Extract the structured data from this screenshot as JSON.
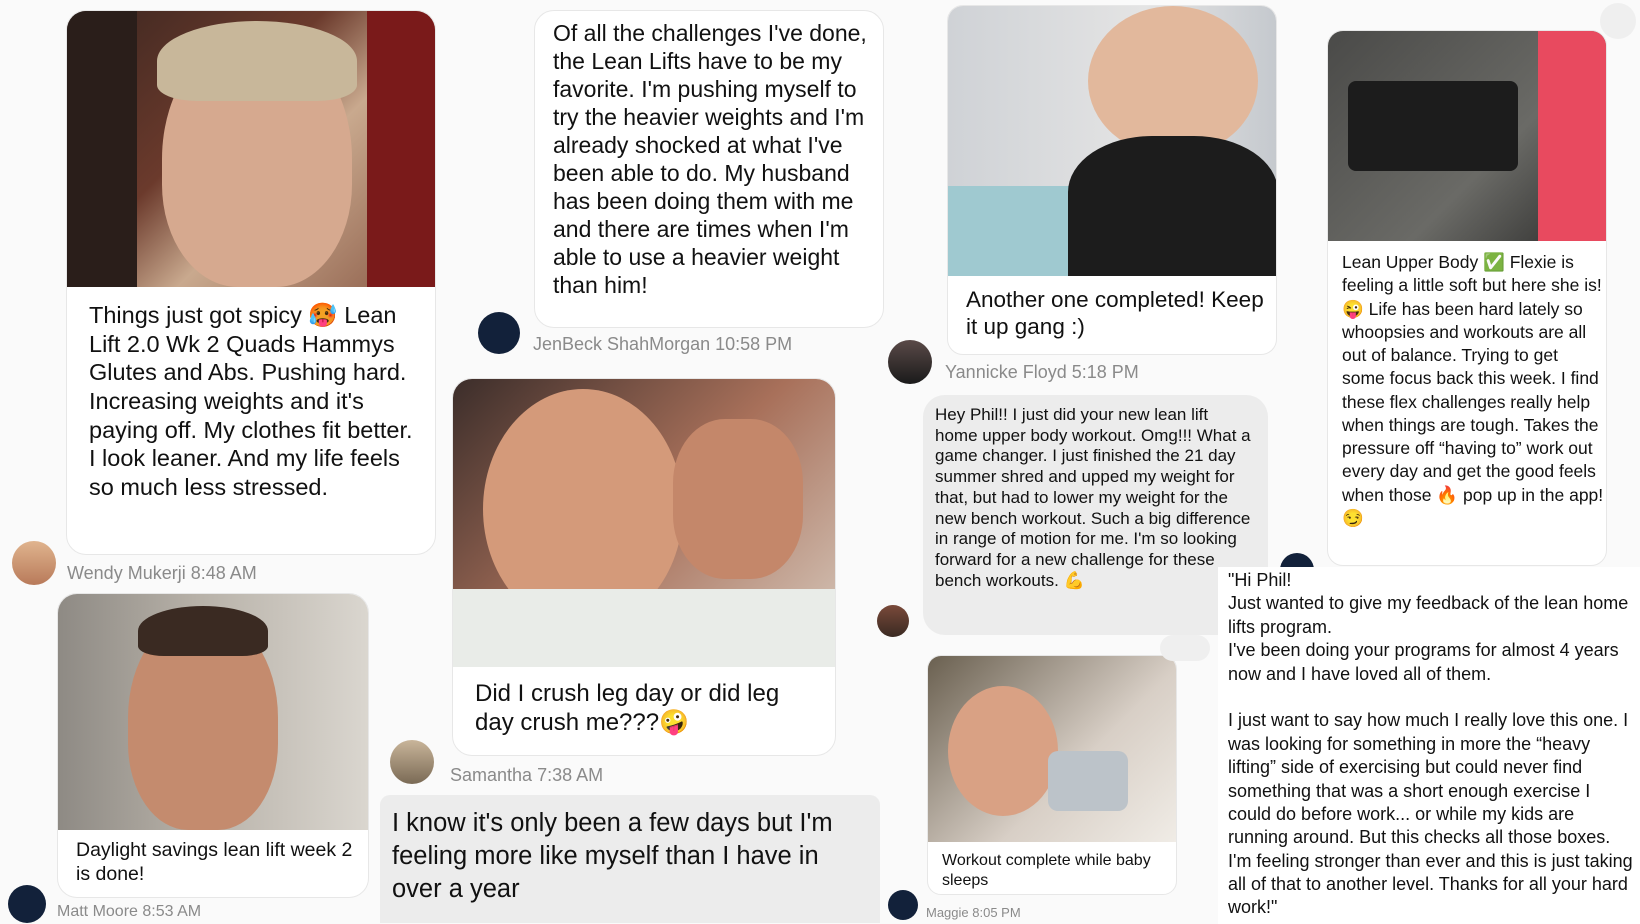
{
  "posts": [
    {
      "text": "Things just got spicy 🥵 Lean Lift 2.0 Wk 2  Quads Hammys Glutes and Abs. Pushing hard. Increasing weights and it's paying off. My clothes fit better. I look leaner. And my life feels so much less stressed.",
      "author": "Wendy Mukerji",
      "time": "8:48 AM"
    },
    {
      "text": "Daylight savings lean lift week 2 is done!",
      "author": "Matt Moore",
      "time": "8:53 AM"
    },
    {
      "text": "Of all the challenges I've done, the Lean Lifts have to be my favorite. I'm pushing myself to try the heavier weights and I'm already shocked at what I've been able to do. My husband has been doing them with me and there are times when I'm able to use a heavier weight than him!",
      "author": "JenBeck ShahMorgan",
      "time": "10:58 PM"
    },
    {
      "text": "Did I crush leg day or did leg day crush me???🤪",
      "author": "Samantha",
      "time": "7:38 AM"
    },
    {
      "text": "I know it's only been a few days but I'm feeling more like myself than I have in over a year"
    },
    {
      "text": "Another one completed!  Keep it up gang :)",
      "author": "Yannicke Floyd",
      "time": "5:18 PM"
    },
    {
      "text": "Hey Phil!! I just did your new lean lift home upper body workout. Omg!!! What a game changer. I just finished the 21 day summer shred and upped my weight for that, but had to lower my weight for the new bench workout. Such a big difference in range of motion for me. I'm so looking forward for a new challenge for these bench workouts. 💪"
    },
    {
      "text": "Workout complete while baby sleeps",
      "author": "Maggie",
      "time": "8:05 PM"
    },
    {
      "text": "Lean Upper Body ✅  Flexie is feeling a little soft but here she is! 😜 Life has been hard lately so whoopsies and workouts are all out of balance. Trying to get some focus back this week.  I find these flex challenges really help when things are tough. Takes the pressure off “having to” work out every day and get the good feels when those 🔥 pop up in the app! 😏"
    },
    {
      "text": "\"Hi Phil!\nJust wanted to give my feedback of the lean home lifts program.\nI've been doing your programs for almost 4 years now and I have loved all of them.\n\nI just want to say how much I really love this one. I was looking for something in more the “heavy lifting” side of exercising but could never find something that was a short enough exercise I could do before work... or while my kids are running around. But this checks all those boxes. I'm feeling stronger than ever and this is just taking all of that to another level. Thanks for all your hard work!\""
    }
  ]
}
